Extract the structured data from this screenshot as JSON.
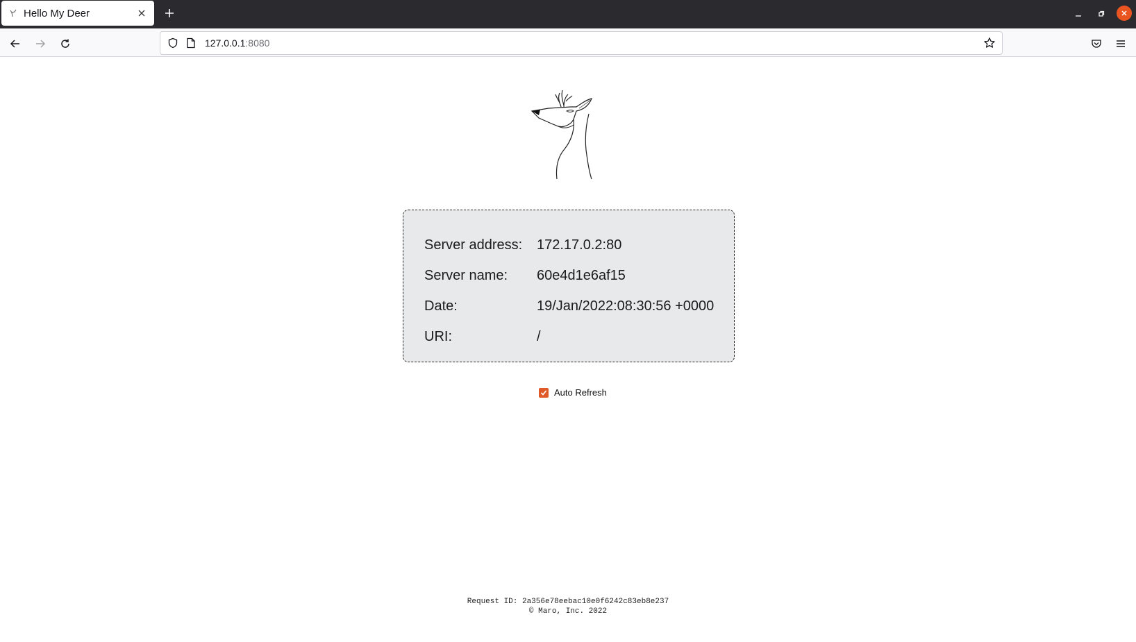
{
  "browser": {
    "tab": {
      "title": "Hello My Deer",
      "favicon": "deer-favicon-icon",
      "close": "close-icon"
    },
    "new_tab": "plus-icon",
    "window_controls": [
      "minimize-icon",
      "restore-icon",
      "close-icon"
    ],
    "address": {
      "host": "127.0.0.1",
      "port": ":8080"
    },
    "accent": "#e95420"
  },
  "page": {
    "info": [
      {
        "label": "Server address:",
        "value": "172.17.0.2:80"
      },
      {
        "label": "Server name:",
        "value": "60e4d1e6af15"
      },
      {
        "label": "Date:",
        "value": "19/Jan/2022:08:30:56 +0000"
      },
      {
        "label": "URI:",
        "value": "/"
      }
    ],
    "auto_refresh": {
      "label": "Auto Refresh",
      "checked": true,
      "color": "#e05a28"
    },
    "footer": {
      "request_id": "Request ID: 2a356e78eebac10e0f6242c83eb8e237",
      "copyright": "© Maro, Inc. 2022"
    }
  }
}
